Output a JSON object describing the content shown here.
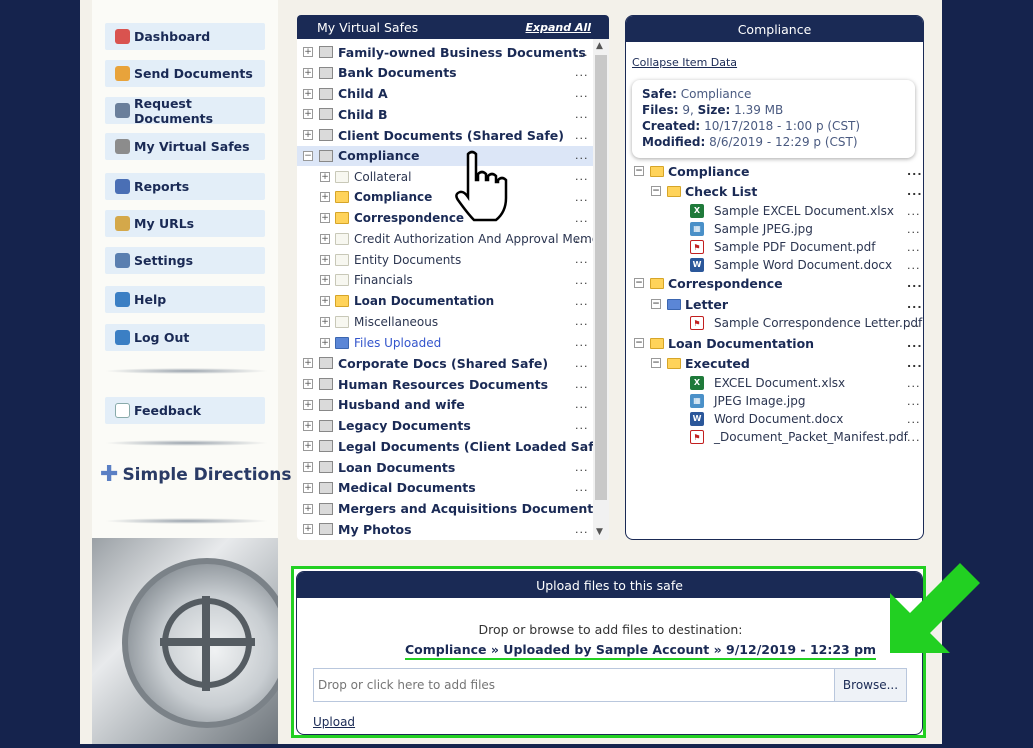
{
  "sidebar": {
    "items": [
      {
        "label": "Dashboard",
        "icon": "dashboard-icon",
        "color": "#d9534f"
      },
      {
        "label": "Send Documents",
        "icon": "send-documents-icon",
        "color": "#e8a33b"
      },
      {
        "label": "Request Documents",
        "icon": "request-documents-icon",
        "color": "#6a7f9b"
      },
      {
        "label": "My Virtual Safes",
        "icon": "safe-icon",
        "color": "#8c8c8c"
      },
      {
        "label": "Reports",
        "icon": "reports-icon",
        "color": "#4a6fb5"
      },
      {
        "label": "My URLs",
        "icon": "urls-icon",
        "color": "#d4a84a"
      },
      {
        "label": "Settings",
        "icon": "settings-icon",
        "color": "#5a7fb0"
      },
      {
        "label": "Help",
        "icon": "help-icon",
        "color": "#3b7fc4"
      },
      {
        "label": "Log Out",
        "icon": "logout-icon",
        "color": "#3b7fc4"
      }
    ],
    "feedback": "Feedback",
    "directions": "Simple Directions"
  },
  "tree": {
    "title": "My Virtual Safes",
    "expand_all": "Expand All",
    "dots": "...",
    "rows": [
      {
        "label": "Family-owned Business Documents",
        "type": "safe"
      },
      {
        "label": "Bank Documents",
        "type": "safe"
      },
      {
        "label": "Child A",
        "type": "safe"
      },
      {
        "label": "Child B",
        "type": "safe"
      },
      {
        "label": "Client Documents (Shared Safe)",
        "type": "safe"
      },
      {
        "label": "Compliance",
        "type": "safe",
        "selected": true,
        "expanded": true
      },
      {
        "label": "Collateral",
        "type": "folder-empty"
      },
      {
        "label": "Compliance",
        "type": "folder-full"
      },
      {
        "label": "Correspondence",
        "type": "folder-full"
      },
      {
        "label": "Credit Authorization And Approval Memo",
        "type": "folder-empty"
      },
      {
        "label": "Entity Documents",
        "type": "folder-empty"
      },
      {
        "label": "Financials",
        "type": "folder-empty"
      },
      {
        "label": "Loan Documentation",
        "type": "folder-full"
      },
      {
        "label": "Miscellaneous",
        "type": "folder-empty"
      },
      {
        "label": "Files Uploaded",
        "type": "folder-blue"
      },
      {
        "label": "Corporate Docs (Shared Safe)",
        "type": "safe"
      },
      {
        "label": "Human Resources Documents",
        "type": "safe"
      },
      {
        "label": "Husband and wife",
        "type": "safe"
      },
      {
        "label": "Legacy Documents",
        "type": "safe"
      },
      {
        "label": "Legal Documents (Client Loaded Safe)",
        "type": "safe"
      },
      {
        "label": "Loan Documents",
        "type": "safe"
      },
      {
        "label": "Medical Documents",
        "type": "safe"
      },
      {
        "label": "Mergers and Acquisitions Documents",
        "type": "safe"
      },
      {
        "label": "My Photos",
        "type": "safe"
      }
    ]
  },
  "info": {
    "title": "Compliance",
    "collapse": "Collapse Item Data",
    "safe_label": "Safe:",
    "safe_value": "Compliance",
    "files_label": "Files:",
    "files_value": "9,",
    "size_label": "Size:",
    "size_value": "1.39 MB",
    "created_label": "Created:",
    "created_value": "10/17/2018 - 1:00 p (CST)",
    "modified_label": "Modified:",
    "modified_value": "8/6/2019 - 12:29 p (CST)",
    "dots": "...",
    "rows": [
      {
        "label": "Compliance",
        "kind": "folder",
        "level": 0
      },
      {
        "label": "Check List",
        "kind": "folder",
        "level": 1
      },
      {
        "label": "Sample EXCEL Document.xlsx",
        "kind": "xlsx",
        "level": 2
      },
      {
        "label": "Sample JPEG.jpg",
        "kind": "jpg",
        "level": 2
      },
      {
        "label": "Sample PDF Document.pdf",
        "kind": "pdf",
        "level": 2
      },
      {
        "label": "Sample Word Document.docx",
        "kind": "docx",
        "level": 2
      },
      {
        "label": "Correspondence",
        "kind": "folder",
        "level": 0
      },
      {
        "label": "Letter",
        "kind": "folder-blue",
        "level": 1
      },
      {
        "label": "Sample Correspondence Letter.pdf",
        "kind": "pdf",
        "level": 2
      },
      {
        "label": "Loan Documentation",
        "kind": "folder",
        "level": 0
      },
      {
        "label": "Executed",
        "kind": "folder",
        "level": 1
      },
      {
        "label": "EXCEL Document.xlsx",
        "kind": "xlsx",
        "level": 2
      },
      {
        "label": "JPEG Image.jpg",
        "kind": "jpg",
        "level": 2
      },
      {
        "label": "Word Document.docx",
        "kind": "docx",
        "level": 2
      },
      {
        "label": "_Document_Packet_Manifest.pdf",
        "kind": "pdf",
        "level": 2
      }
    ]
  },
  "upload": {
    "title": "Upload files to this safe",
    "drop_text": "Drop or browse to add files to destination:",
    "destination": "Compliance » Uploaded by Sample Account » 9/12/2019 - 12:23 pm",
    "placeholder": "Drop or click here to add files",
    "browse": "Browse...",
    "link": "Upload"
  },
  "colors": {
    "navy": "#1a2a55",
    "highlight_green": "#22d022"
  }
}
